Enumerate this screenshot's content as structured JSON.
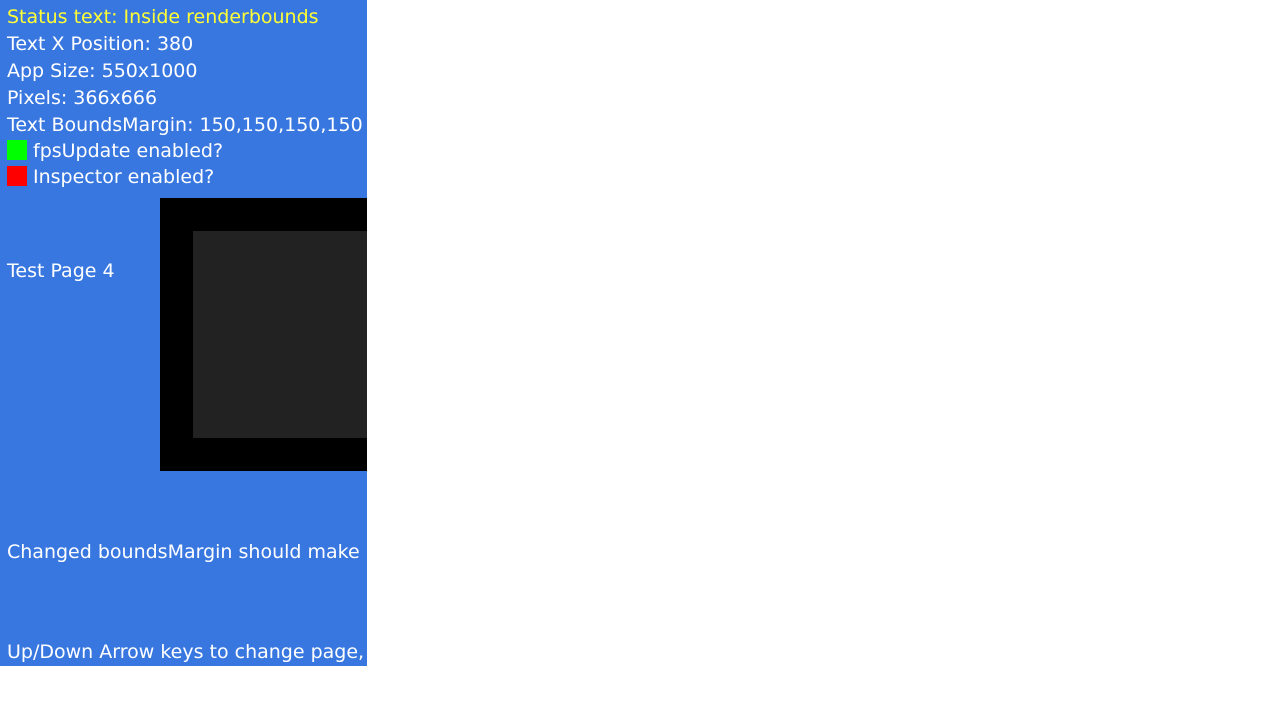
{
  "status": {
    "text": "Status text: Inside renderbounds",
    "color": "#ffff33"
  },
  "info": {
    "text_x": "Text X Position: 380",
    "app_size": "App Size: 550x1000",
    "pixels": "Pixels: 366x666",
    "bounds_margin": "Text BoundsMargin: 150,150,150,150"
  },
  "toggles": [
    {
      "label": "fpsUpdate enabled?",
      "color": "#00ff00"
    },
    {
      "label": "Inspector enabled?",
      "color": "#ff0000"
    }
  ],
  "page": {
    "label": "Test Page 4"
  },
  "notes": {
    "changed": "Changed boundsMargin should make re",
    "hint": "Up/Down Arrow keys to change page, er"
  },
  "colors": {
    "background": "#3877e0",
    "text": "#ffffff",
    "outer_box": "#000000",
    "inner_box": "#222222"
  }
}
